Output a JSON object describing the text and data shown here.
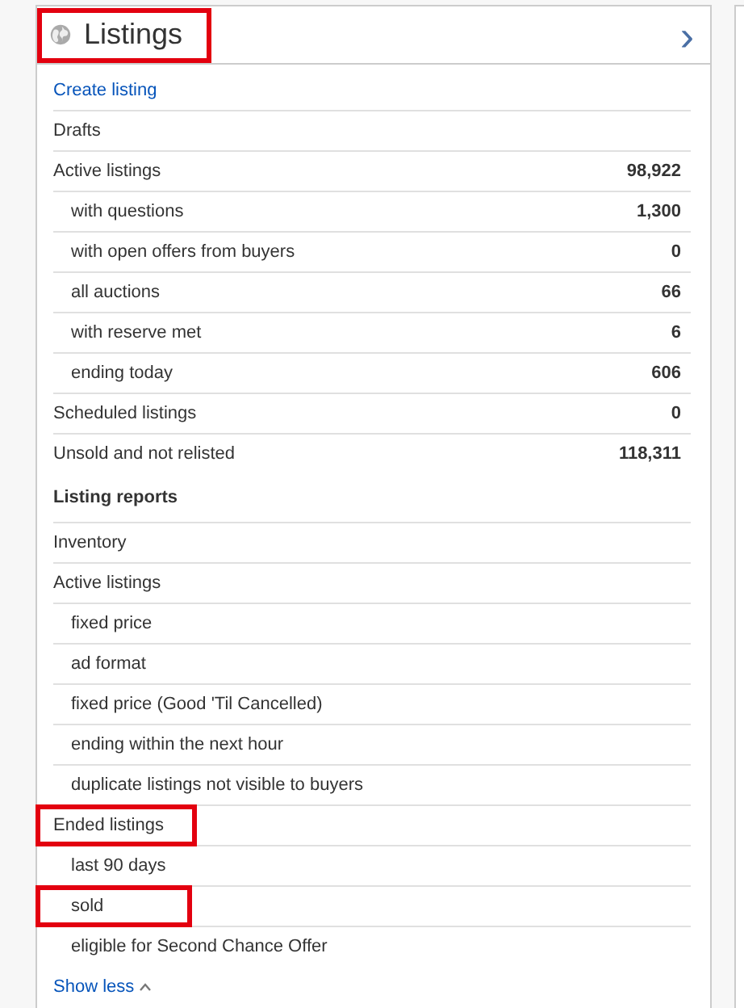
{
  "header": {
    "title": "Listings",
    "highlighted": true,
    "chevron": "›"
  },
  "sections": [
    {
      "items": [
        {
          "kind": "link",
          "label": "Create listing",
          "highlighted": false
        },
        {
          "kind": "item",
          "label": "Drafts",
          "highlighted": false
        },
        {
          "kind": "item",
          "label": "Active listings",
          "value": "98,922",
          "highlighted": false,
          "children": [
            {
              "kind": "item",
              "label": "with questions",
              "value": "1,300",
              "highlighted": false
            },
            {
              "kind": "item",
              "label": "with open offers from buyers",
              "value": "0",
              "highlighted": false
            },
            {
              "kind": "item",
              "label": "all auctions",
              "value": "66",
              "highlighted": false
            },
            {
              "kind": "item",
              "label": "with reserve met",
              "value": "6",
              "highlighted": false
            },
            {
              "kind": "item",
              "label": "ending today",
              "value": "606",
              "highlighted": false
            }
          ]
        },
        {
          "kind": "item",
          "label": "Scheduled listings",
          "value": "0",
          "highlighted": false
        },
        {
          "kind": "item",
          "label": "Unsold and not relisted",
          "value": "118,311",
          "highlighted": false
        }
      ]
    },
    {
      "heading": "Listing reports",
      "items": [
        {
          "kind": "item",
          "label": "Inventory",
          "highlighted": false
        },
        {
          "kind": "item",
          "label": "Active listings",
          "highlighted": false,
          "children": [
            {
              "kind": "item",
              "label": "fixed price",
              "highlighted": false
            },
            {
              "kind": "item",
              "label": "ad format",
              "highlighted": false
            },
            {
              "kind": "item",
              "label": "fixed price (Good 'Til Cancelled)",
              "highlighted": false
            },
            {
              "kind": "item",
              "label": "ending within the next hour",
              "highlighted": false
            },
            {
              "kind": "item",
              "label": "duplicate listings not visible to buyers",
              "highlighted": false
            }
          ]
        },
        {
          "kind": "item",
          "label": "Ended listings",
          "highlighted": true,
          "children": [
            {
              "kind": "item",
              "label": "last 90 days",
              "highlighted": false
            },
            {
              "kind": "item",
              "label": "sold",
              "highlighted": true
            },
            {
              "kind": "item",
              "label": "eligible for Second Chance Offer",
              "highlighted": false
            }
          ]
        }
      ]
    }
  ],
  "footer": {
    "label": "Show less"
  }
}
